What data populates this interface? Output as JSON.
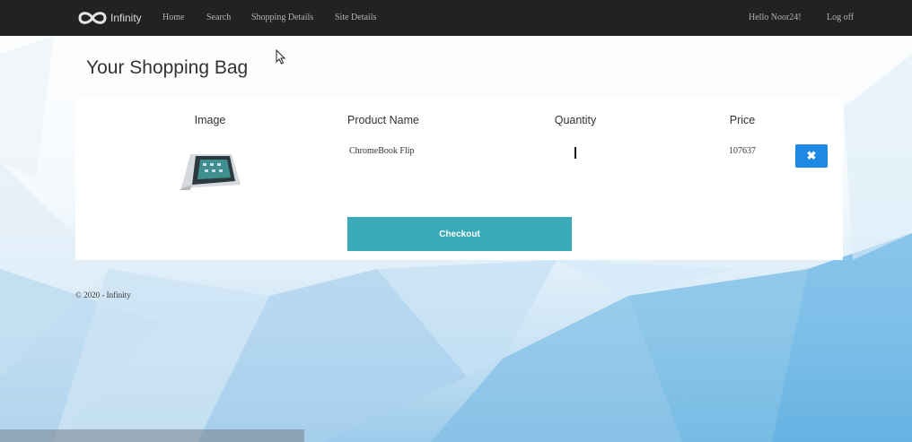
{
  "navbar": {
    "brand": "Infinity",
    "links": [
      "Home",
      "Search",
      "Shopping Details",
      "Site Details"
    ],
    "greeting": "Hello Noor24!",
    "logout": "Log off"
  },
  "cart": {
    "title": "Your Shopping Bag",
    "columns": [
      "Image",
      "Product Name",
      "Quantity",
      "Price"
    ],
    "items": [
      {
        "image_icon": "laptop-image",
        "name": "ChromeBook Flip",
        "quantity": "1",
        "price": "107637",
        "remove_icon": "close-icon"
      }
    ],
    "checkout_label": "Checkout"
  },
  "footer": {
    "text": "© 2020 - Infinity"
  },
  "colors": {
    "navbar_bg": "#222222",
    "remove_button": "#1e88e5",
    "checkout_button": "#3aa9b8"
  }
}
